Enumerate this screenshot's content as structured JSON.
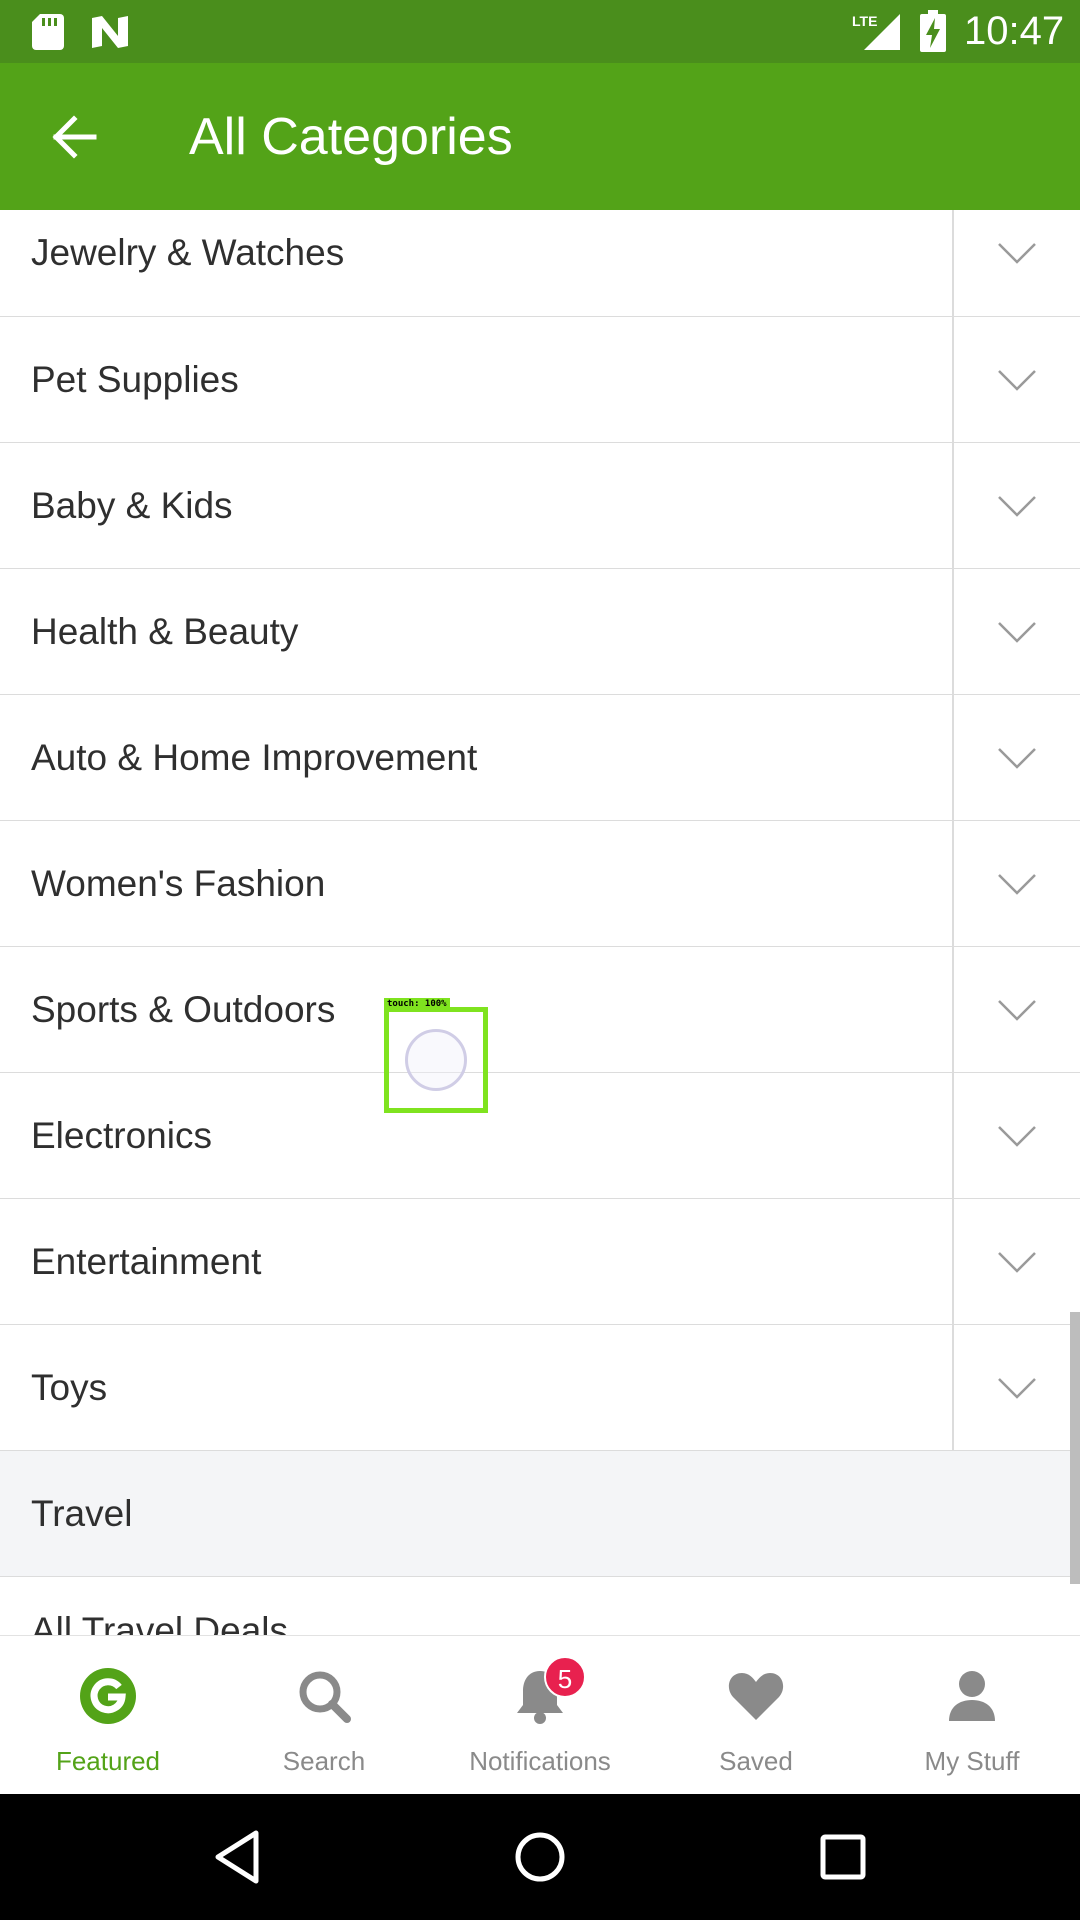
{
  "status_bar": {
    "time": "10:47",
    "icons": [
      "sd-card-icon",
      "n-notification-icon",
      "lte-signal-icon",
      "battery-charging-icon"
    ],
    "network": "LTE"
  },
  "app_bar": {
    "title": "All Categories",
    "back_icon": "arrow-left-icon"
  },
  "categories": [
    {
      "label": "Jewelry & Watches"
    },
    {
      "label": "Pet Supplies"
    },
    {
      "label": "Baby & Kids"
    },
    {
      "label": "Health & Beauty"
    },
    {
      "label": "Auto & Home Improvement"
    },
    {
      "label": "Women's Fashion"
    },
    {
      "label": "Sports & Outdoors"
    },
    {
      "label": "Electronics"
    },
    {
      "label": "Entertainment"
    },
    {
      "label": "Toys"
    }
  ],
  "travel_section": {
    "header": "Travel",
    "first_item": "All Travel Deals"
  },
  "touch_overlay": {
    "label": "touch: 100%"
  },
  "bottom_nav": {
    "items": [
      {
        "label": "Featured",
        "icon": "groupon-g-icon",
        "active": true
      },
      {
        "label": "Search",
        "icon": "search-icon",
        "active": false
      },
      {
        "label": "Notifications",
        "icon": "bell-icon",
        "active": false,
        "badge": "5"
      },
      {
        "label": "Saved",
        "icon": "heart-icon",
        "active": false
      },
      {
        "label": "My Stuff",
        "icon": "person-icon",
        "active": false
      }
    ]
  },
  "colors": {
    "status_bar": "#4a8e1c",
    "app_bar": "#53a318",
    "active_nav": "#53a318",
    "inactive_nav": "#8a8a8a",
    "badge": "#e8214f",
    "section_header_bg": "#f4f5f7"
  }
}
